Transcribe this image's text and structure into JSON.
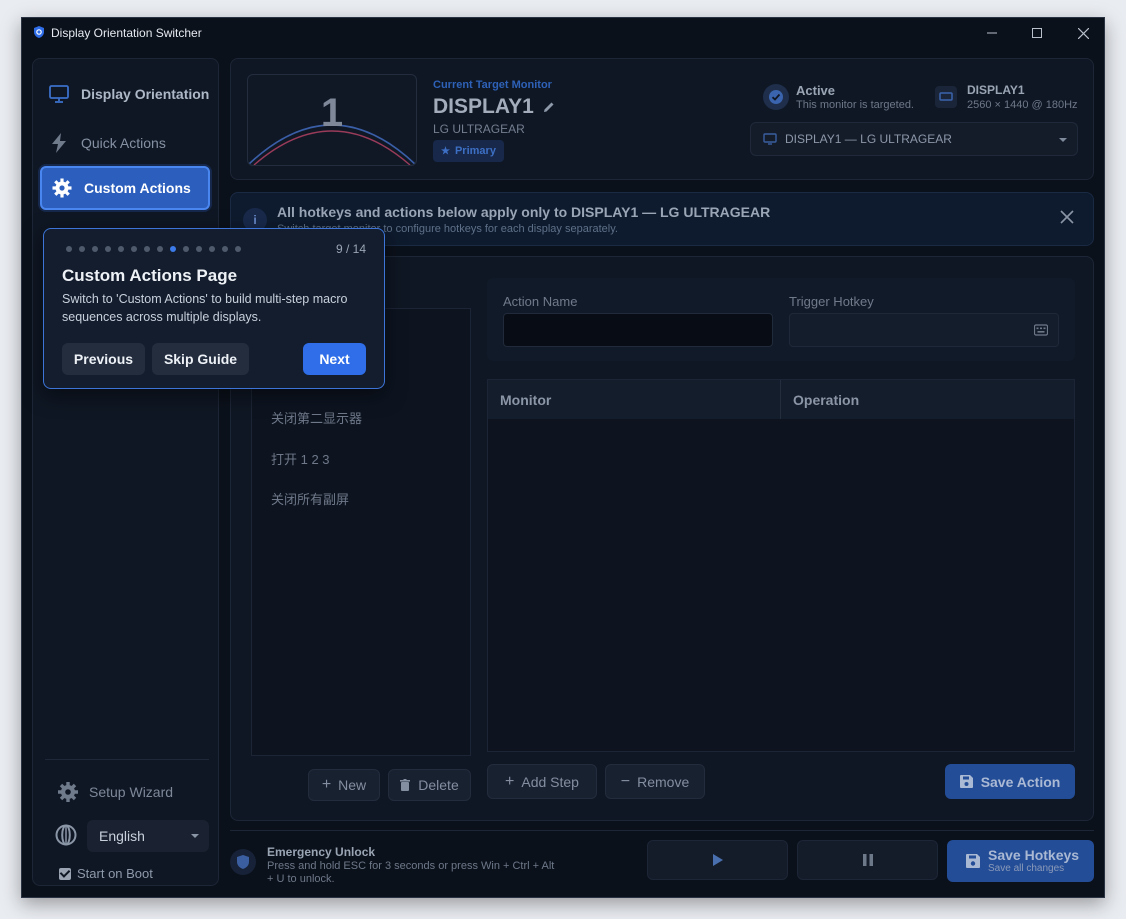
{
  "window": {
    "title": "Display Orientation Switcher"
  },
  "sidebar": {
    "items": [
      {
        "label": "Display Orientation",
        "icon": "monitor-icon"
      },
      {
        "label": "Quick Actions",
        "icon": "lightning-icon"
      },
      {
        "label": "Custom Actions",
        "icon": "gear-icon",
        "active": true
      }
    ],
    "setup_wizard": "Setup Wizard",
    "language": "English",
    "start_on_boot": {
      "label": "Start on Boot",
      "checked": true
    }
  },
  "target": {
    "preview_number": "1",
    "label": "Current Target Monitor",
    "name": "DISPLAY1",
    "model": "LG ULTRAGEAR",
    "badge": "Primary",
    "status_title": "Active",
    "status_sub": "This monitor is targeted.",
    "display_title": "DISPLAY1",
    "display_sub": "2560 × 1440 @ 180Hz",
    "selected_monitor": "DISPLAY1 — LG ULTRAGEAR"
  },
  "banner": {
    "title": "All hotkeys and actions below apply only to DISPLAY1 — LG ULTRAGEAR",
    "sub": "Switch target monitor to configure hotkeys for each display separately."
  },
  "actions": {
    "list": [
      "关闭第二显示器",
      "打开 1 2 3",
      "关闭所有副屏"
    ],
    "new_label": "New",
    "delete_label": "Delete",
    "action_name_label": "Action Name",
    "action_name_value": "",
    "trigger_hotkey_label": "Trigger Hotkey",
    "trigger_hotkey_value": "",
    "columns": [
      "Monitor",
      "Operation"
    ],
    "add_step_label": "Add Step",
    "remove_label": "Remove",
    "save_action_label": "Save Action"
  },
  "bottom": {
    "emergency_title": "Emergency Unlock",
    "emergency_sub": "Press and hold ESC for 3 seconds or press Win + Ctrl + Alt + U to unlock.",
    "save_hotkeys": "Save Hotkeys",
    "save_hotkeys_sub": "Save all changes"
  },
  "tour": {
    "current": 9,
    "total": 14,
    "count": "9 / 14",
    "title": "Custom Actions Page",
    "description": "Switch to 'Custom Actions' to build multi-step macro sequences across multiple displays.",
    "previous": "Previous",
    "skip": "Skip Guide",
    "next": "Next"
  },
  "colors": {
    "accent": "#2f6ee8",
    "background": "#0b111b",
    "panel": "#0f1724"
  }
}
